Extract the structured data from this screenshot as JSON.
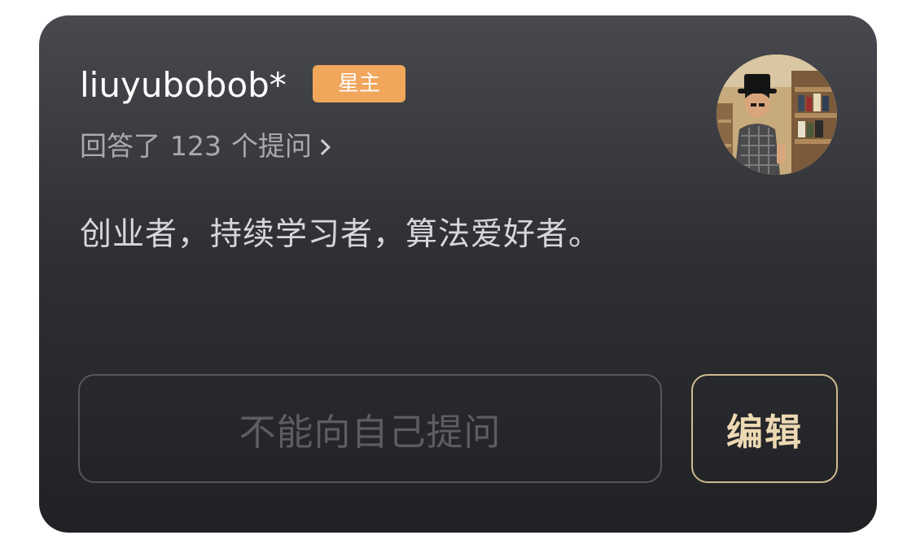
{
  "profile": {
    "username": "liuyubobob*",
    "badge_label": "星主",
    "answers_prefix": "回答了",
    "answers_count": "123",
    "answers_suffix": "个提问",
    "bio": "创业者，持续学习者，算法爱好者。"
  },
  "actions": {
    "ask_label": "不能向自己提问",
    "edit_label": "编辑"
  },
  "icons": {
    "answers_arrow": "chevron-right-icon",
    "avatar": "user-avatar-photo"
  },
  "colors": {
    "badge": "#f0a65b",
    "edit_border": "#cdbb8f",
    "edit_text": "#ecd9b3",
    "card_top": "#48494e",
    "card_bottom": "#202124"
  }
}
